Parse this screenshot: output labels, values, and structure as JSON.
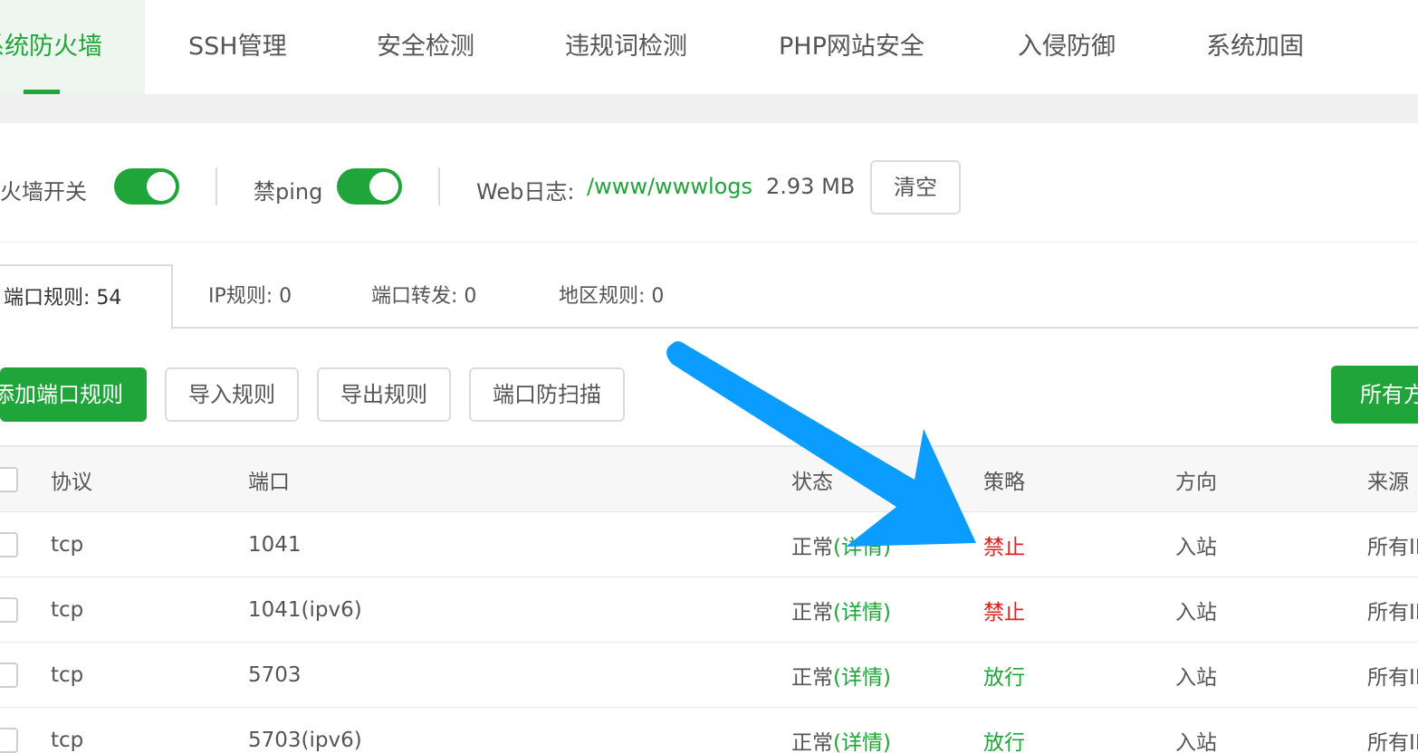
{
  "nav": {
    "tabs": [
      {
        "label": "系统防火墙",
        "active": true
      },
      {
        "label": "SSH管理"
      },
      {
        "label": "安全检测"
      },
      {
        "label": "违规词检测"
      },
      {
        "label": "PHP网站安全"
      },
      {
        "label": "入侵防御"
      },
      {
        "label": "系统加固"
      }
    ]
  },
  "toolbar": {
    "firewall_switch_label": "防火墙开关",
    "firewall_switch_on": true,
    "ping_label": "禁ping",
    "ping_switch_on": true,
    "weblog_label": "Web日志:",
    "weblog_path": "/www/wwwlogs",
    "weblog_size": "2.93 MB",
    "clear_button": "清空"
  },
  "subtabs": [
    {
      "label": "端口规则: 54",
      "active": true
    },
    {
      "label": "IP规则: 0"
    },
    {
      "label": "端口转发: 0"
    },
    {
      "label": "地区规则: 0"
    }
  ],
  "actions": {
    "add_rule": "添加端口规则",
    "import_rules": "导入规则",
    "export_rules": "导出规则",
    "anti_scan": "端口防扫描",
    "direction_filter": "所有方"
  },
  "table": {
    "headers": {
      "protocol": "协议",
      "port": "端口",
      "status": "状态",
      "policy": "策略",
      "direction": "方向",
      "source": "来源"
    },
    "rows": [
      {
        "protocol": "tcp",
        "port": "1041",
        "status": "正常",
        "detail": "(详情)",
        "policy": "禁止",
        "policy_type": "deny",
        "direction": "入站",
        "source": "所有IP"
      },
      {
        "protocol": "tcp",
        "port": "1041(ipv6)",
        "status": "正常",
        "detail": "(详情)",
        "policy": "禁止",
        "policy_type": "deny",
        "direction": "入站",
        "source": "所有IP"
      },
      {
        "protocol": "tcp",
        "port": "5703",
        "status": "正常",
        "detail": "(详情)",
        "policy": "放行",
        "policy_type": "allow",
        "direction": "入站",
        "source": "所有IP"
      },
      {
        "protocol": "tcp",
        "port": "5703(ipv6)",
        "status": "正常",
        "detail": "(详情)",
        "policy": "放行",
        "policy_type": "allow",
        "direction": "入站",
        "source": "所有IP"
      }
    ]
  },
  "colors": {
    "accent": "#20a53a",
    "deny": "#e02020",
    "annotation_arrow": "#0a9cff"
  }
}
